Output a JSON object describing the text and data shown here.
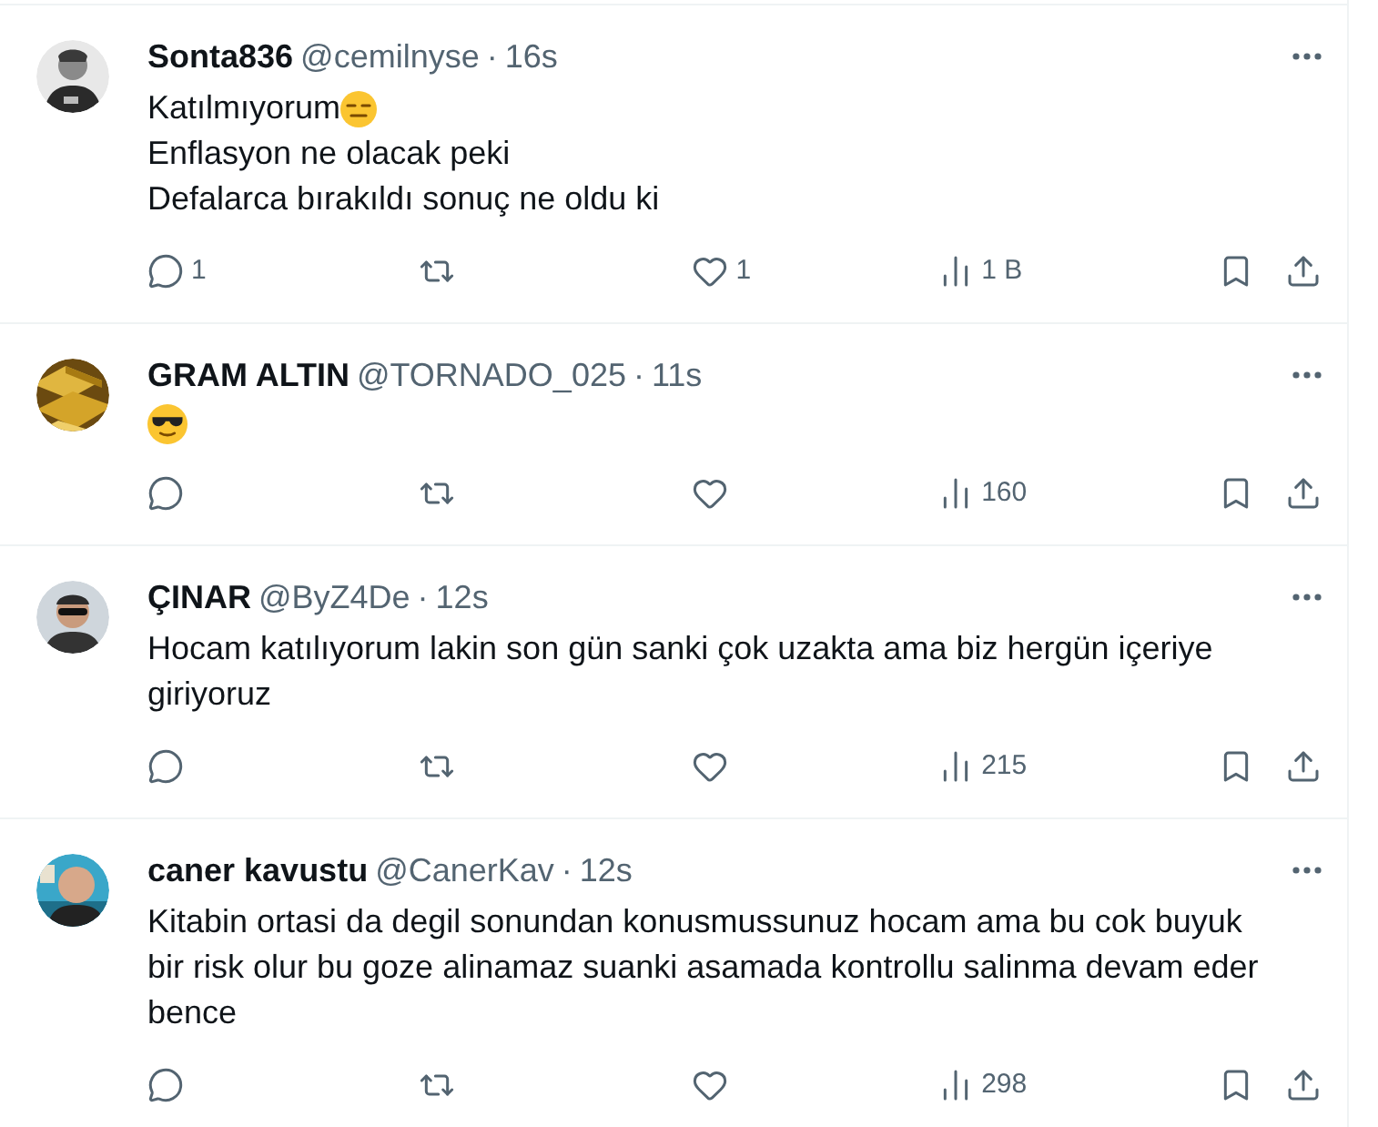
{
  "tweets": [
    {
      "name": "Sonta836",
      "handle": "@cemilnyse",
      "separator": "·",
      "time": "16s",
      "body": [
        {
          "text": "Katılmıyorum",
          "emoji": {
            "kind": "expressionless"
          }
        },
        {
          "text": "Enflasyon ne olacak peki"
        },
        {
          "text": "Defalarca bırakıldı sonuç ne oldu ki"
        }
      ],
      "replies": "1",
      "likes": "1",
      "views": "1 B"
    },
    {
      "name": "GRAM ALTIN",
      "handle": "@TORNADO_025",
      "separator": "·",
      "time": "11s",
      "body": [
        {
          "emoji": {
            "kind": "sunglasses"
          }
        }
      ],
      "views": "160"
    },
    {
      "name": "ÇINAR",
      "handle": "@ByZ4De",
      "separator": "·",
      "time": "12s",
      "body": [
        {
          "text": "Hocam katılıyorum lakin son gün sanki çok uzakta ama biz hergün içeriye giriyoruz"
        }
      ],
      "views": "215"
    },
    {
      "name": "caner kavustu",
      "handle": "@CanerKav",
      "separator": "·",
      "time": "12s",
      "body": [
        {
          "text": "Kitabin ortasi da degil sonundan konusmussunuz hocam ama bu cok buyuk bir risk olur bu goze alinamaz suanki asamada kontrollu salinma devam eder bence"
        }
      ],
      "views": "298"
    }
  ]
}
